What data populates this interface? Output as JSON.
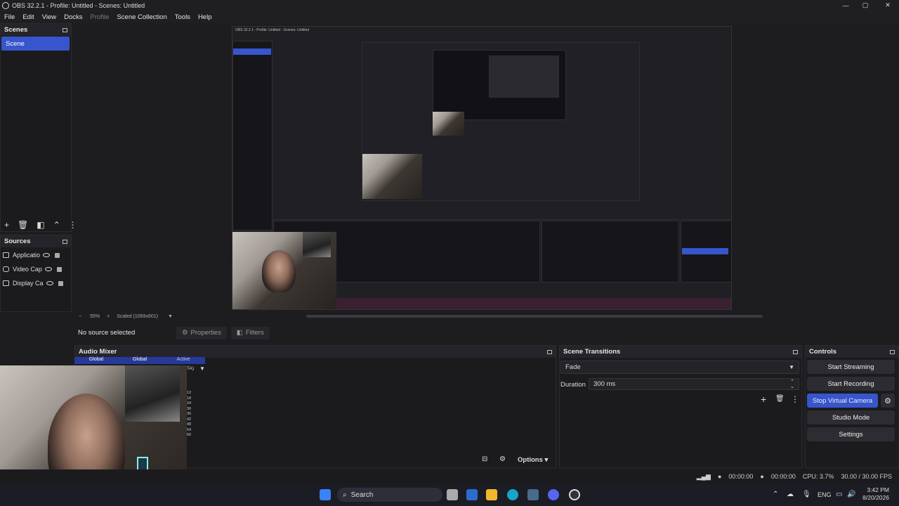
{
  "window": {
    "title": "OBS 32.2.1 - Profile: Untitled - Scenes: Untitled"
  },
  "menu": [
    "File",
    "Edit",
    "View",
    "Docks",
    "Profile",
    "Scene Collection",
    "Tools",
    "Help"
  ],
  "scenes": {
    "header": "Scenes",
    "items": [
      "Scene"
    ]
  },
  "sources": {
    "header": "Sources",
    "items": [
      {
        "label": "Applicatio",
        "icon": "application-icon"
      },
      {
        "label": "Video Cap",
        "icon": "camera-icon"
      },
      {
        "label": "Display Ca",
        "icon": "monitor-icon"
      }
    ]
  },
  "preview": {
    "inner_title": "OBS 32.2.1 - Profile: Untitled - Scenes: Untitled",
    "zoom": "55%",
    "scale_label": "Scaled (1069x601)"
  },
  "source_bar": {
    "no_source": "No source selected",
    "properties": "Properties",
    "filters": "Filters"
  },
  "audio_mixer": {
    "header": "Audio Mixer",
    "tabs": [
      "Global",
      "Global",
      "Active"
    ],
    "partial_label": "TA)",
    "scale": [
      "12",
      "18",
      "24",
      "30",
      "36",
      "42",
      "48",
      "54",
      "60"
    ],
    "options": "Options"
  },
  "transitions": {
    "header": "Scene Transitions",
    "selected": "Fade",
    "duration_label": "Duration",
    "duration_value": "300 ms"
  },
  "controls": {
    "header": "Controls",
    "start_streaming": "Start Streaming",
    "start_recording": "Start Recording",
    "stop_virtual_camera": "Stop Virtual Camera",
    "studio_mode": "Studio Mode",
    "settings": "Settings"
  },
  "status": {
    "stream_time": "00:00:00",
    "rec_time": "00:00:00",
    "cpu": "CPU: 3.7%",
    "fps": "30.00 / 30.00 FPS"
  },
  "taskbar": {
    "search": "Search",
    "language": "ENG",
    "time": "3:42 PM",
    "date": "8/20/2026"
  },
  "colors": {
    "accent": "#3755cc",
    "background": "#1d1d20",
    "panel": "#1b1b1e",
    "taskbar": "#1c1c24"
  }
}
